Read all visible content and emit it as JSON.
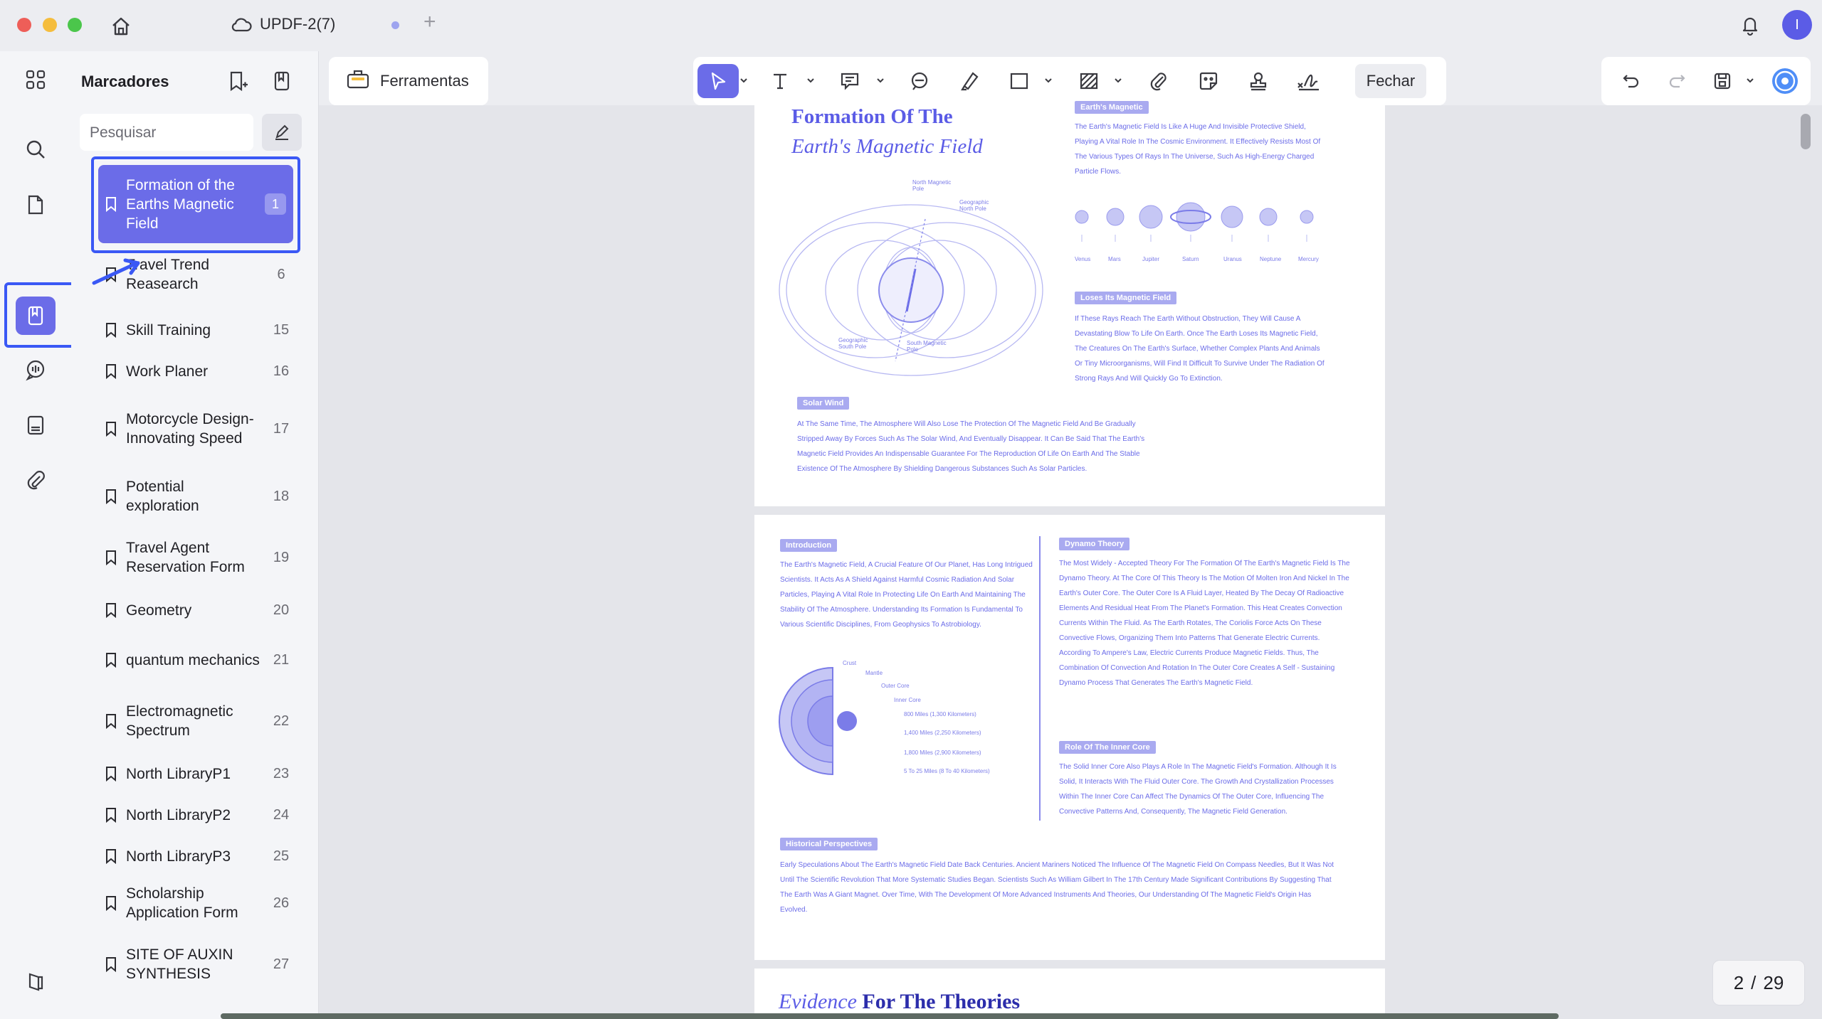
{
  "app": {
    "tab_title": "UPDF-2(7)",
    "tab_plus": "+",
    "avatar_initial": "I"
  },
  "sidebar": {
    "title": "Marcadores",
    "search_placeholder": "Pesquisar",
    "bookmarks": [
      {
        "label": "Formation of the Earths Magnetic Field",
        "page": "1",
        "active": true
      },
      {
        "label": "Travel Trend Reasearch",
        "page": "6"
      },
      {
        "label": "Skill Training",
        "page": "15"
      },
      {
        "label": "Work Planer",
        "page": "16"
      },
      {
        "label": "Motorcycle Design-Innovating Speed",
        "page": "17"
      },
      {
        "label": "Potential exploration",
        "page": "18"
      },
      {
        "label": "Travel Agent Reservation Form",
        "page": "19"
      },
      {
        "label": "Geometry",
        "page": "20"
      },
      {
        "label": "quantum mechanics",
        "page": "21"
      },
      {
        "label": "Electromagnetic Spectrum",
        "page": "22"
      },
      {
        "label": "North LibraryP1",
        "page": "23"
      },
      {
        "label": "North LibraryP2",
        "page": "24"
      },
      {
        "label": "North LibraryP3",
        "page": "25"
      },
      {
        "label": "Scholarship Application Form",
        "page": "26"
      },
      {
        "label": "SITE OF AUXIN SYNTHESIS",
        "page": "27"
      }
    ]
  },
  "toolbar": {
    "tools_label": "Ferramentas",
    "close_label": "Fechar"
  },
  "document": {
    "page1": {
      "title_line1": "Formation Of The",
      "title_line2": "Earth's Magnetic Field",
      "chip_top": "Earth's Magnetic",
      "intro_text": "The Earth's Magnetic Field Is Like A Huge And Invisible Protective Shield, Playing A Vital Role In The Cosmic Environment. It Effectively Resists Most Of The Various Types Of Rays In The Universe, Such As High-Energy Charged Particle Flows.",
      "chip_loses": "Loses Its Magnetic Field",
      "loses_text": "If These Rays Reach The Earth Without Obstruction, They Will Cause A Devastating Blow To Life On Earth. Once The Earth Loses Its Magnetic Field, The Creatures On The Earth's Surface, Whether Complex Plants And Animals Or Tiny Microorganisms, Will Find It Difficult To Survive Under The Radiation Of Strong Rays And Will Quickly Go To Extinction.",
      "chip_solar": "Solar Wind",
      "solar_text": "At The Same Time, The Atmosphere Will Also Lose The Protection Of The Magnetic Field And Be Gradually Stripped Away By Forces Such As The Solar Wind, And Eventually Disappear. It Can Be Said That The Earth's Magnetic Field Provides An Indispensable Guarantee For The Reproduction Of Life On Earth And The Stable Existence Of The Atmosphere By Shielding Dangerous Substances Such As Solar Particles.",
      "planets": [
        "Venus",
        "Mars",
        "Jupiter",
        "Saturn",
        "Uranus",
        "Neptune",
        "Mercury"
      ],
      "diagram_labels": [
        "North Magnetic Pole",
        "Geographic North Pole",
        "Geographic South Pole",
        "South Magnetic Pole"
      ]
    },
    "page2": {
      "chip_intro": "Introduction",
      "intro_text": "The Earth's Magnetic Field, A Crucial Feature Of Our Planet, Has Long Intrigued Scientists. It Acts As A Shield Against Harmful Cosmic Radiation And Solar Particles, Playing A Vital Role In Protecting Life On Earth And Maintaining The Stability Of The Atmosphere. Understanding Its Formation Is Fundamental To Various Scientific Disciplines, From Geophysics To Astrobiology.",
      "chip_dynamo": "Dynamo Theory",
      "dynamo_text": "The Most Widely - Accepted Theory For The Formation Of The Earth's Magnetic Field Is The Dynamo Theory. At The Core Of This Theory Is The Motion Of Molten Iron And Nickel In The Earth's Outer Core. The Outer Core Is A Fluid Layer, Heated By The Decay Of Radioactive Elements And Residual Heat From The Planet's Formation. This Heat Creates Convection Currents Within The Fluid. As The Earth Rotates, The Coriolis Force Acts On These Convective Flows, Organizing Them Into Patterns That Generate Electric Currents. According To Ampere's Law, Electric Currents Produce Magnetic Fields. Thus, The Combination Of Convection And Rotation In The Outer Core Creates A Self - Sustaining Dynamo Process That Generates The Earth's Magnetic Field.",
      "chip_inner": "Role Of The Inner Core",
      "inner_text": "The Solid Inner Core Also Plays A Role In The Magnetic Field's Formation. Although It Is Solid, It Interacts With The Fluid Outer Core. The Growth And Crystallization Processes Within The Inner Core Can Affect The Dynamics Of The Outer Core, Influencing The Convective Patterns And, Consequently, The Magnetic Field Generation.",
      "chip_hist": "Historical Perspectives",
      "hist_text": "Early Speculations About The Earth's Magnetic Field Date Back Centuries. Ancient Mariners Noticed The Influence Of The Magnetic Field On Compass Needles, But It Was Not Until The Scientific Revolution That More Systematic Studies Began. Scientists Such As William Gilbert In The 17th Century Made Significant Contributions By Suggesting That The Earth Was A Giant Magnet. Over Time, With The Development Of More Advanced Instruments And Theories, Our Understanding Of The Magnetic Field's Origin Has Evolved.",
      "core_labels": [
        "Crust",
        "Mantle",
        "Outer Core",
        "Inner Core"
      ],
      "depth_labels": [
        "800 Miles (1,300 Kilometers)",
        "1,400 Miles (2,250 Kilometers)",
        "1,800 Miles (2,900 Kilometers)",
        "5 To 25 Miles (8 To 40 Kilometers)"
      ]
    },
    "page3": {
      "title_italic": "Evidence",
      "title_rest": " For The Theories"
    }
  },
  "pager": {
    "current": "2",
    "separator": "/",
    "total": "29"
  },
  "colors": {
    "accent": "#6b6ce8",
    "highlight_frame": "#3a58f5",
    "doc_text": "#5b5ce6"
  }
}
